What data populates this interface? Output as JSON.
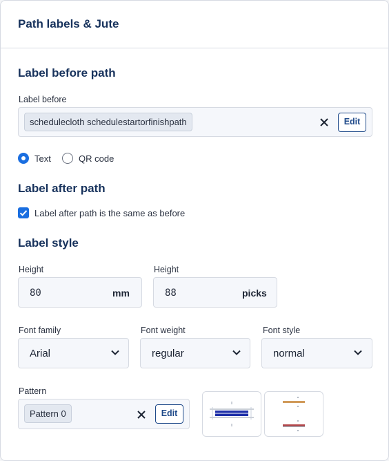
{
  "panel": {
    "title": "Path labels & Jute"
  },
  "label_before": {
    "section_title": "Label before path",
    "field_label": "Label before",
    "chip": "schedulecloth schedulestartorfinishpath",
    "edit_label": "Edit",
    "clear_icon": "close-icon"
  },
  "label_type": {
    "options": [
      {
        "label": "Text",
        "selected": true
      },
      {
        "label": "QR code",
        "selected": false
      }
    ]
  },
  "label_after": {
    "section_title": "Label after path",
    "checkbox_label": "Label after path is the same as before",
    "checked": true
  },
  "label_style": {
    "section_title": "Label style",
    "height_mm": {
      "label": "Height",
      "value": "80",
      "unit": "mm"
    },
    "height_picks": {
      "label": "Height",
      "value": "88",
      "unit": "picks"
    },
    "font_family": {
      "label": "Font family",
      "value": "Arial"
    },
    "font_weight": {
      "label": "Font weight",
      "value": "regular"
    },
    "font_style": {
      "label": "Font style",
      "value": "normal"
    }
  },
  "pattern": {
    "label": "Pattern",
    "chip": "Pattern 0",
    "edit_label": "Edit",
    "clear_icon": "close-icon"
  },
  "colors": {
    "accent": "#1a6ee0",
    "title": "#17325c",
    "thumb_band": "#1e2fa8",
    "thumb_orange": "#d09a5a",
    "thumb_red": "#b5474a"
  }
}
